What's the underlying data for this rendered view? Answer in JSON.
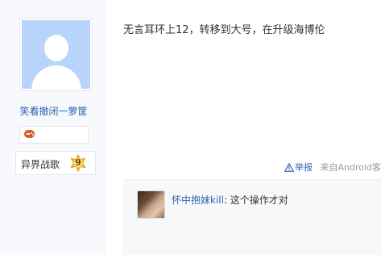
{
  "user": {
    "name": "笑看撤闭一箩筐",
    "badge_name": "异界战歌",
    "badge_level": "9"
  },
  "post": {
    "content": "无言耳环上12，转移到大号，在升级海博伦",
    "report_label": "举报",
    "source": "来自Android客"
  },
  "reply": {
    "username": "怀中抱妹kill",
    "text": ": 这个操作才对"
  },
  "colors": {
    "link": "#2d64b3",
    "sidebar_bg": "#f7f9fc",
    "avatar_bg": "#b8d4fb",
    "reply_bg": "#f7f8fa"
  }
}
